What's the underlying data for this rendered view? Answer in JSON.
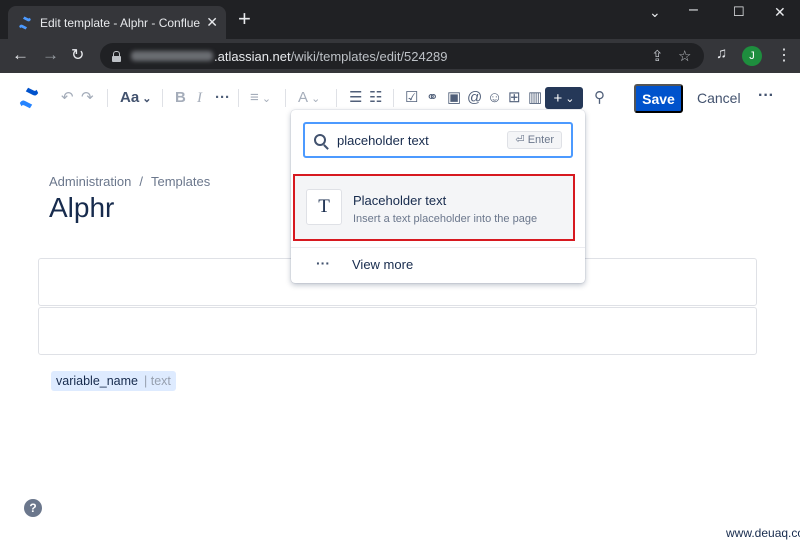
{
  "browser": {
    "tab_title": "Edit template - Alphr - Confluence",
    "new_tab_icon": "+",
    "url_host_suffix": ".atlassian.net",
    "url_path": "/wiki/templates/edit/524289",
    "profile_initial": "J"
  },
  "toolbar": {
    "text_style_label": "Aa",
    "save_label": "Save",
    "cancel_label": "Cancel"
  },
  "page": {
    "breadcrumb": [
      "Administration",
      "Templates"
    ],
    "title": "Alphr",
    "placeholder_chip": {
      "name": "variable_name",
      "type": "| text"
    }
  },
  "insert_popup": {
    "search_value": "placeholder text",
    "enter_hint": "⏎ Enter",
    "item": {
      "icon_letter": "T",
      "title": "Placeholder text",
      "description": "Insert a text placeholder into the page"
    },
    "view_more": "View more"
  },
  "watermark": "www.deuaq.com",
  "colors": {
    "primary": "#0052cc",
    "highlight_border": "#d71920",
    "chip_bg": "#deebff"
  }
}
